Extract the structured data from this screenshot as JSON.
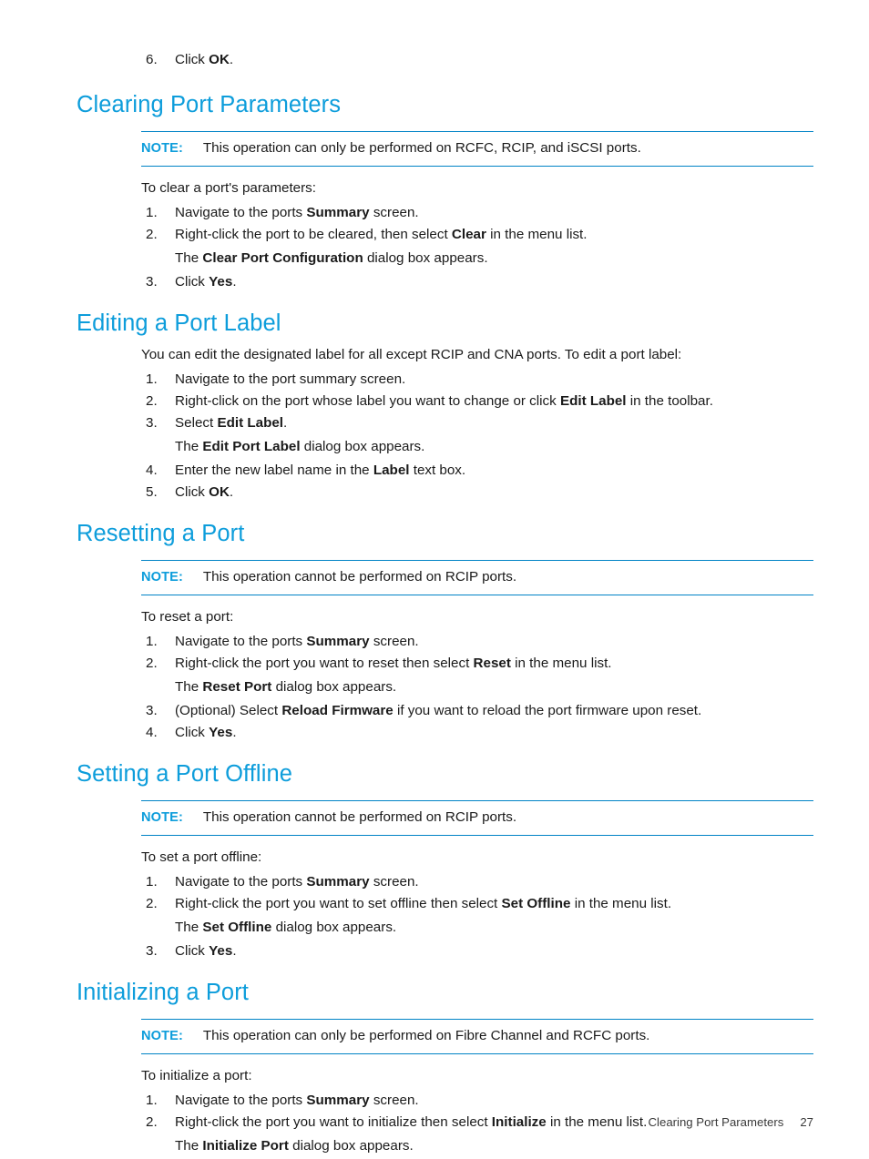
{
  "document": {
    "heading_color": "#0d9ddb",
    "rule_color": "#0083c6",
    "body_color": "#1a1a1a"
  },
  "top_step": {
    "number": "6.",
    "text_before": "Click ",
    "bold": "OK",
    "text_after": "."
  },
  "sections": [
    {
      "id": "clearing-port-parameters",
      "heading": "Clearing Port Parameters",
      "note": {
        "label": "NOTE:",
        "text": "This operation can only be performed on RCFC, RCIP, and iSCSI ports."
      },
      "lead": "To clear a port's parameters:",
      "steps": [
        {
          "number": "1.",
          "parts": [
            {
              "t": "Navigate to the ports "
            },
            {
              "b": "Summary"
            },
            {
              "t": " screen."
            }
          ]
        },
        {
          "number": "2.",
          "parts": [
            {
              "t": "Right-click the port to be cleared, then select "
            },
            {
              "b": "Clear"
            },
            {
              "t": " in the menu list."
            }
          ],
          "continuation": [
            {
              "t": "The "
            },
            {
              "b": "Clear Port Configuration"
            },
            {
              "t": " dialog box appears."
            }
          ]
        },
        {
          "number": "3.",
          "parts": [
            {
              "t": "Click "
            },
            {
              "b": "Yes"
            },
            {
              "t": "."
            }
          ]
        }
      ]
    },
    {
      "id": "editing-a-port-label",
      "heading": "Editing a Port Label",
      "note": null,
      "lead": "You can edit the designated label for all except RCIP and CNA ports. To edit a port label:",
      "steps": [
        {
          "number": "1.",
          "parts": [
            {
              "t": "Navigate to the port summary screen."
            }
          ]
        },
        {
          "number": "2.",
          "parts": [
            {
              "t": "Right-click on the port whose label you want to change or click "
            },
            {
              "b": "Edit Label"
            },
            {
              "t": " in the toolbar."
            }
          ]
        },
        {
          "number": "3.",
          "parts": [
            {
              "t": "Select "
            },
            {
              "b": "Edit Label"
            },
            {
              "t": "."
            }
          ],
          "continuation": [
            {
              "t": "The "
            },
            {
              "b": "Edit Port Label"
            },
            {
              "t": " dialog box appears."
            }
          ]
        },
        {
          "number": "4.",
          "parts": [
            {
              "t": "Enter the new label name in the "
            },
            {
              "b": "Label"
            },
            {
              "t": " text box."
            }
          ]
        },
        {
          "number": "5.",
          "parts": [
            {
              "t": "Click "
            },
            {
              "b": "OK"
            },
            {
              "t": "."
            }
          ]
        }
      ]
    },
    {
      "id": "resetting-a-port",
      "heading": "Resetting a Port",
      "note": {
        "label": "NOTE:",
        "text": "This operation cannot be performed on RCIP ports."
      },
      "lead": "To reset a port:",
      "steps": [
        {
          "number": "1.",
          "parts": [
            {
              "t": "Navigate to the ports "
            },
            {
              "b": "Summary"
            },
            {
              "t": " screen."
            }
          ]
        },
        {
          "number": "2.",
          "parts": [
            {
              "t": "Right-click the port you want to reset then select "
            },
            {
              "b": "Reset"
            },
            {
              "t": " in the menu list."
            }
          ],
          "continuation": [
            {
              "t": "The "
            },
            {
              "b": "Reset Port"
            },
            {
              "t": " dialog box appears."
            }
          ]
        },
        {
          "number": "3.",
          "parts": [
            {
              "t": "(Optional) Select "
            },
            {
              "b": "Reload Firmware"
            },
            {
              "t": " if you want to reload the port firmware upon reset."
            }
          ]
        },
        {
          "number": "4.",
          "parts": [
            {
              "t": "Click "
            },
            {
              "b": "Yes"
            },
            {
              "t": "."
            }
          ]
        }
      ]
    },
    {
      "id": "setting-a-port-offline",
      "heading": "Setting a Port Offline",
      "note": {
        "label": "NOTE:",
        "text": "This operation cannot be performed on RCIP ports."
      },
      "lead": "To set a port offline:",
      "steps": [
        {
          "number": "1.",
          "parts": [
            {
              "t": "Navigate to the ports "
            },
            {
              "b": "Summary"
            },
            {
              "t": " screen."
            }
          ]
        },
        {
          "number": "2.",
          "parts": [
            {
              "t": "Right-click the port you want to set offline then select "
            },
            {
              "b": "Set Offline"
            },
            {
              "t": " in the menu list."
            }
          ],
          "continuation": [
            {
              "t": "The "
            },
            {
              "b": "Set Offline"
            },
            {
              "t": " dialog box appears."
            }
          ]
        },
        {
          "number": "3.",
          "parts": [
            {
              "t": "Click "
            },
            {
              "b": "Yes"
            },
            {
              "t": "."
            }
          ]
        }
      ]
    },
    {
      "id": "initializing-a-port",
      "heading": "Initializing a Port",
      "note": {
        "label": "NOTE:",
        "text": "This operation can only be performed on Fibre Channel and RCFC ports."
      },
      "lead": "To initialize a port:",
      "steps": [
        {
          "number": "1.",
          "parts": [
            {
              "t": "Navigate to the ports "
            },
            {
              "b": "Summary"
            },
            {
              "t": " screen."
            }
          ]
        },
        {
          "number": "2.",
          "parts": [
            {
              "t": "Right-click the port you want to initialize then select "
            },
            {
              "b": "Initialize"
            },
            {
              "t": " in the menu list."
            }
          ],
          "continuation": [
            {
              "t": "The "
            },
            {
              "b": "Initialize Port"
            },
            {
              "t": " dialog box appears."
            }
          ]
        }
      ]
    }
  ],
  "footer": {
    "title": "Clearing Port Parameters",
    "page_number": "27"
  }
}
